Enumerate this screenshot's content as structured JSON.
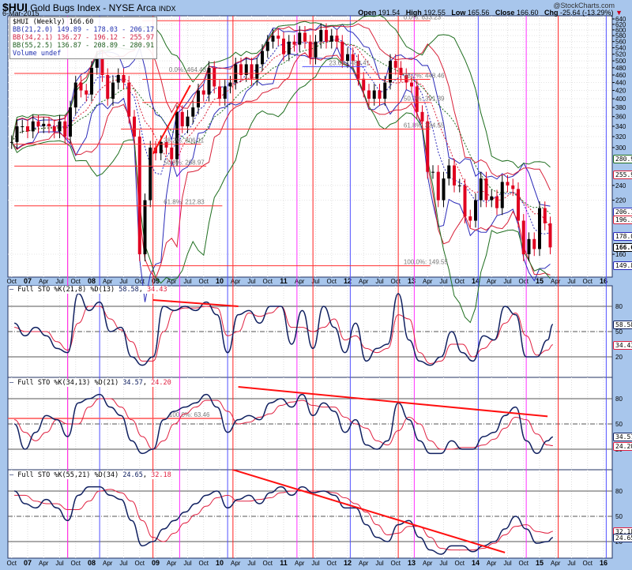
{
  "header": {
    "symbol": "$HUI",
    "title": "Gold Bugs Index - NYSE Arca",
    "exchange": "INDX",
    "date": "6-Mar-2015",
    "watermark": "@StockCharts.com",
    "ohlc": [
      {
        "label": "Open",
        "value": "191.54"
      },
      {
        "label": "High",
        "value": "192.55"
      },
      {
        "label": "Low",
        "value": "165.56"
      },
      {
        "label": "Close",
        "value": "166.60"
      },
      {
        "label": "Chg",
        "value": "-25.64 (-13.29%)"
      }
    ]
  },
  "legend": {
    "price": "$HUI (Weekly) 166.60",
    "bb1": "BB(21,2.0) 149.89 - 178.03 - 206.17",
    "bb2": "BB(34,2.1) 136.27 - 196.12 - 255.97",
    "bb3": "BB(55,2.5) 136.87 - 208.89 - 280.91",
    "volume": "Volume undef"
  },
  "colors": {
    "bb1": "#2a2ab8",
    "bb2": "#d82038",
    "bb3": "#1f6e1f",
    "stoK": "#102060",
    "stoD": "#e02040",
    "up": "#000000",
    "down": "#e00020",
    "red_line": "#ff2020",
    "magenta_line": "#ff30ff",
    "blue_line": "#5050ff"
  },
  "chart_data": [
    {
      "type": "candlestick",
      "scale": "log",
      "ylim": [
        145,
        650
      ],
      "grid": true,
      "x_start": "2006-10",
      "interval": "monthly",
      "close": [
        310,
        340,
        340,
        330,
        350,
        340,
        345,
        340,
        330,
        350,
        320,
        380,
        440,
        420,
        410,
        480,
        510,
        460,
        400,
        440,
        460,
        440,
        360,
        320,
        160,
        220,
        300,
        290,
        310,
        300,
        280,
        370,
        340,
        360,
        380,
        420,
        410,
        480,
        430,
        400,
        430,
        440,
        490,
        460,
        490,
        450,
        490,
        530,
        560,
        580,
        570,
        520,
        560,
        550,
        590,
        560,
        510,
        560,
        600,
        560,
        580,
        560,
        500,
        520,
        500,
        450,
        420,
        400,
        420,
        400,
        440,
        500,
        480,
        460,
        440,
        430,
        370,
        350,
        260,
        260,
        220,
        250,
        270,
        240,
        240,
        200,
        195,
        220,
        250,
        220,
        225,
        210,
        245,
        240,
        235,
        195,
        160,
        175,
        165,
        210,
        192,
        166.6
      ],
      "bollinger": [
        {
          "name": "BB(21,2.0)",
          "period": 21,
          "k": 2.0,
          "color": "#2a2ab8"
        },
        {
          "name": "BB(34,2.1)",
          "period": 34,
          "k": 2.1,
          "color": "#d82038"
        },
        {
          "name": "BB(55,2.5)",
          "period": 55,
          "k": 2.5,
          "color": "#1f6e1f"
        }
      ],
      "y_ticks": [
        640,
        620,
        600,
        580,
        560,
        540,
        520,
        500,
        480,
        460,
        440,
        420,
        400,
        380,
        360,
        340,
        320,
        300,
        240,
        220,
        160
      ],
      "y_tags": [
        {
          "value": "280.91",
          "color": "#1f6e1f",
          "price": 280.91
        },
        {
          "value": "255.97",
          "color": "#d82038",
          "price": 255.97
        },
        {
          "value": "206.17",
          "color": "#2a2ab8",
          "price": 206.17
        },
        {
          "value": "196.12",
          "color": "#d82038",
          "price": 196.12
        },
        {
          "value": "178.03",
          "color": "#2a2ab8",
          "price": 178.03
        },
        {
          "value": "166.60",
          "color": "#000000",
          "price": 166.6
        },
        {
          "value": "149.89",
          "color": "#2a2ab8",
          "price": 149.89
        }
      ],
      "fib_levels": [
        {
          "label": "0.0%: 464.43",
          "price": 464.43,
          "from": "2006-10",
          "to": "2013-04",
          "label_at": "2009-03"
        },
        {
          "label": "38.2%: 306.11",
          "price": 306.11,
          "from": "2006-10",
          "to": "2009-09",
          "label_at": "2009-02"
        },
        {
          "label": "50.0%: 268.97",
          "price": 268.97,
          "from": "2006-10",
          "to": "2009-10",
          "label_at": "2009-02"
        },
        {
          "label": "61.8%: 212.83",
          "price": 212.83,
          "from": "2006-10",
          "to": "2010-01",
          "label_at": "2009-02"
        },
        {
          "label": "0.0%: 633.23",
          "price": 633.23,
          "from": "2008-10",
          "to": "2013-04",
          "label_at": "2012-11"
        },
        {
          "label": "23.6%: 483.41",
          "price": 483.41,
          "from": "2011-04",
          "to": "2012-04",
          "label_at": "2011-09",
          "color": "#5050ff"
        },
        {
          "label": "38.2%: 448.46",
          "price": 448.46,
          "from": "2008-10",
          "to": "2013-04",
          "label_at": "2012-11"
        },
        {
          "label": "50.0%: 391.39",
          "price": 391.39,
          "from": "2008-10",
          "to": "2013-04",
          "label_at": "2012-11"
        },
        {
          "label": "61.8%: 334.55",
          "price": 334.55,
          "from": "2008-06",
          "to": "2013-04",
          "label_at": "2012-11"
        },
        {
          "label": "100.0%: 149.55",
          "price": 149.55,
          "from": "2008-10",
          "to": "2013-04",
          "label_at": "2012-11"
        }
      ],
      "trendlines": [
        {
          "from": [
            "2008-12",
            289
          ],
          "to": [
            "2009-07",
            433
          ]
        }
      ]
    },
    {
      "type": "line",
      "label": "Full STO %K(21,8) %D(13)",
      "k_value": "58.58",
      "d_value": "34.43",
      "ylim": [
        0,
        100
      ],
      "y_ticks": [
        80,
        50,
        20
      ],
      "x_start": "2006-10",
      "interval": "bimonthly",
      "k": [
        60,
        45,
        55,
        45,
        30,
        25,
        95,
        75,
        85,
        50,
        55,
        20,
        10,
        20,
        80,
        75,
        80,
        75,
        85,
        70,
        25,
        70,
        75,
        60,
        80,
        80,
        35,
        75,
        30,
        80,
        55,
        25,
        60,
        15,
        30,
        35,
        95,
        40,
        15,
        10,
        20,
        50,
        25,
        15,
        45,
        40,
        80,
        70,
        20,
        20,
        40,
        58.58
      ],
      "d": [
        55,
        50,
        50,
        50,
        38,
        28,
        60,
        80,
        80,
        65,
        52,
        38,
        15,
        15,
        50,
        75,
        78,
        78,
        80,
        78,
        45,
        50,
        72,
        68,
        72,
        80,
        55,
        55,
        50,
        55,
        65,
        40,
        45,
        30,
        25,
        30,
        70,
        65,
        25,
        12,
        15,
        35,
        35,
        20,
        30,
        40,
        60,
        72,
        45,
        22,
        28,
        34.43
      ],
      "tags": [
        {
          "value": "58.58",
          "level": 58.58,
          "color": "#102060"
        },
        {
          "value": "34.43",
          "level": 34.43,
          "color": "#e02040"
        }
      ],
      "trendlines": [
        {
          "from": [
            "2008-12",
            87.5
          ],
          "to": [
            "2010-04",
            80
          ]
        }
      ]
    },
    {
      "type": "line",
      "label": "Full STO %K(34,13) %D(21)",
      "k_value": "34.57",
      "d_value": "24.20",
      "ylim": [
        0,
        100
      ],
      "y_ticks": [
        80,
        50,
        20
      ],
      "x_start": "2006-10",
      "interval": "bimonthly",
      "k": [
        50,
        20,
        40,
        60,
        55,
        35,
        75,
        80,
        85,
        70,
        60,
        30,
        15,
        20,
        55,
        65,
        70,
        75,
        85,
        70,
        40,
        55,
        60,
        55,
        75,
        80,
        70,
        85,
        60,
        75,
        65,
        40,
        55,
        25,
        20,
        30,
        75,
        55,
        30,
        15,
        15,
        30,
        20,
        20,
        35,
        40,
        60,
        70,
        30,
        15,
        30,
        34.57
      ],
      "d": [
        55,
        40,
        30,
        40,
        55,
        50,
        50,
        70,
        80,
        80,
        70,
        55,
        35,
        20,
        30,
        50,
        62,
        70,
        78,
        78,
        65,
        50,
        52,
        58,
        62,
        72,
        76,
        78,
        72,
        70,
        70,
        58,
        50,
        45,
        30,
        25,
        42,
        58,
        50,
        30,
        20,
        20,
        22,
        22,
        25,
        32,
        45,
        58,
        55,
        38,
        25,
        24.2
      ],
      "tags": [
        {
          "value": "34.57",
          "level": 34.57,
          "color": "#102060"
        },
        {
          "value": "24.20",
          "level": 24.2,
          "color": "#e02040"
        }
      ],
      "fib_levels": [
        {
          "label": "100.0%: 63.46",
          "level": 56.5,
          "from": "2006-10",
          "to": "2010-01",
          "label_at": "2009-03"
        }
      ],
      "trendlines": [
        {
          "from": [
            "2010-04",
            94
          ],
          "to": [
            "2015-02",
            59
          ]
        }
      ]
    },
    {
      "type": "line",
      "label": "Full STO %K(55,21) %D(34)",
      "k_value": "24.65",
      "d_value": "32.18",
      "ylim": [
        0,
        100
      ],
      "y_ticks": [
        80,
        50,
        20
      ],
      "x_start": "2006-10",
      "interval": "bimonthly",
      "k": [
        80,
        65,
        60,
        70,
        60,
        45,
        75,
        85,
        85,
        75,
        70,
        45,
        15,
        20,
        35,
        45,
        55,
        65,
        75,
        80,
        60,
        70,
        75,
        65,
        78,
        85,
        75,
        85,
        78,
        80,
        75,
        60,
        60,
        40,
        25,
        20,
        40,
        45,
        25,
        10,
        5,
        15,
        15,
        8,
        15,
        20,
        35,
        50,
        35,
        18,
        20,
        24.65
      ],
      "d": [
        75,
        75,
        68,
        65,
        65,
        58,
        58,
        68,
        80,
        82,
        78,
        68,
        45,
        25,
        20,
        30,
        42,
        52,
        62,
        72,
        75,
        68,
        68,
        70,
        72,
        78,
        80,
        80,
        80,
        80,
        78,
        72,
        65,
        55,
        40,
        28,
        30,
        38,
        38,
        25,
        12,
        10,
        10,
        10,
        12,
        18,
        28,
        38,
        40,
        32,
        30,
        32.18
      ],
      "tags": [
        {
          "value": "32.18",
          "level": 32.18,
          "color": "#e02040"
        },
        {
          "value": "24.65",
          "level": 24.65,
          "color": "#102060"
        }
      ],
      "trendlines": [
        {
          "from": [
            "2009-11",
            113
          ],
          "to": [
            "2014-06",
            7
          ]
        }
      ]
    }
  ],
  "x_axis": {
    "start": "2006-10",
    "labels": [
      "Oct",
      "07",
      "Apr",
      "Jul",
      "Oct",
      "08",
      "Apr",
      "Jul",
      "Oct",
      "09",
      "Apr",
      "Jul",
      "Oct",
      "10",
      "Apr",
      "Jul",
      "Oct",
      "11",
      "Apr",
      "Jul",
      "Oct",
      "12",
      "Apr",
      "Jul",
      "Oct",
      "13",
      "Apr",
      "Jul",
      "Oct",
      "14",
      "Apr",
      "Jul",
      "Oct",
      "15",
      "Apr",
      "Jul",
      "Oct",
      "16"
    ]
  },
  "markers": {
    "red": [
      "2007-08",
      "2008-12",
      "2010-03",
      "2011-06",
      "2012-10",
      "2015-04"
    ],
    "magenta": [
      "2007-08",
      "2009-05",
      "2011-03",
      "2013-01",
      "2014-10"
    ],
    "blue": [
      "2008-02",
      "2010-02",
      "2012-01",
      "2014-01",
      "2016-01"
    ]
  }
}
